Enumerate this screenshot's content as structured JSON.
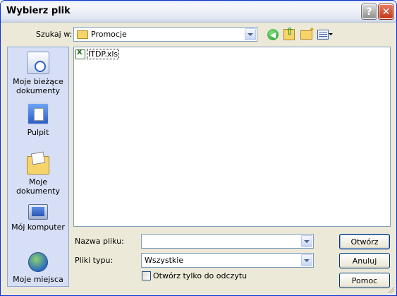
{
  "window": {
    "title": "Wybierz plik",
    "help_label": "?",
    "close_label": "✕"
  },
  "toolbar": {
    "lookin_label": "Szukaj w:",
    "lookin_value": "Promocje",
    "back_icon": "back-arrow-icon",
    "up_icon": "up-folder-icon",
    "newfolder_icon": "new-folder-icon",
    "views_icon": "views-menu-icon"
  },
  "places": [
    {
      "label": "Moje bieżące dokumenty",
      "icon": "recent-documents-icon"
    },
    {
      "label": "Pulpit",
      "icon": "desktop-icon"
    },
    {
      "label": "Moje dokumenty",
      "icon": "my-documents-icon"
    },
    {
      "label": "Mój komputer",
      "icon": "my-computer-icon"
    },
    {
      "label": "Moje miejsca",
      "icon": "network-places-icon"
    }
  ],
  "files": [
    {
      "name": "ITDP.xls",
      "icon": "excel-file-icon"
    }
  ],
  "form": {
    "filename_label": "Nazwa pliku:",
    "filename_value": "",
    "filetype_label": "Pliki typu:",
    "filetype_value": "Wszystkie",
    "readonly_label": "Otwórz tylko do odczytu",
    "readonly_checked": false
  },
  "buttons": {
    "open": "Otwórz",
    "cancel": "Anuluj",
    "help": "Pomoc"
  },
  "colors": {
    "titlebar": "#dfe7f5",
    "dialog": "#ece9d8",
    "places_bg": "#d6dff5",
    "close_button": "#c4391b"
  }
}
